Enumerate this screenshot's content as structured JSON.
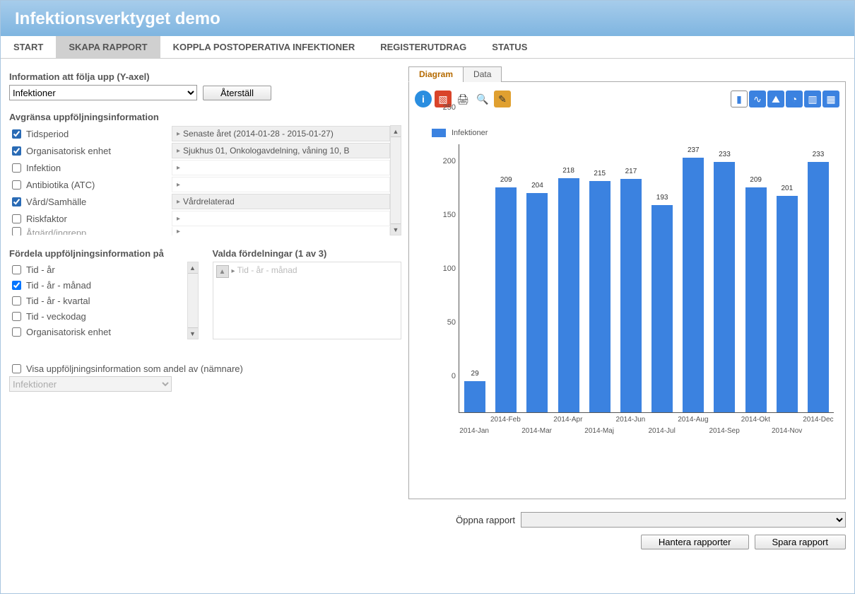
{
  "header": {
    "title": "Infektionsverktyget demo"
  },
  "tabs": [
    "START",
    "SKAPA RAPPORT",
    "KOPPLA POSTOPERATIVA INFEKTIONER",
    "REGISTERUTDRAG"
  ],
  "tabs_right": "STATUS",
  "active_tab_index": 1,
  "yaxis": {
    "label": "Information att följa upp (Y-axel)",
    "selected": "Infektioner",
    "reset_btn": "Återställ"
  },
  "filters": {
    "heading": "Avgränsa uppföljningsinformation",
    "items": [
      {
        "label": "Tidsperiod",
        "checked": true,
        "value": "Senaste året (2014-01-28 - 2015-01-27)"
      },
      {
        "label": "Organisatorisk enhet",
        "checked": true,
        "value": "Sjukhus 01, Onkologavdelning, våning 10, B"
      },
      {
        "label": "Infektion",
        "checked": false,
        "value": ""
      },
      {
        "label": "Antibiotika (ATC)",
        "checked": false,
        "value": ""
      },
      {
        "label": "Vård/Samhälle",
        "checked": true,
        "value": "Vårdrelaterad"
      },
      {
        "label": "Riskfaktor",
        "checked": false,
        "value": ""
      },
      {
        "label": "Åtgärd/ingrepp",
        "checked": false,
        "value": ""
      }
    ]
  },
  "distribution": {
    "heading": "Fördela uppföljningsinformation på",
    "items": [
      {
        "label": "Tid - år",
        "checked": false
      },
      {
        "label": "Tid - år - månad",
        "checked": true
      },
      {
        "label": "Tid - år - kvartal",
        "checked": false
      },
      {
        "label": "Tid - veckodag",
        "checked": false
      },
      {
        "label": "Organisatorisk enhet",
        "checked": false
      }
    ],
    "selected_heading": "Valda fördelningar (1 av 3)",
    "selected_item": "Tid - år - månad"
  },
  "denominator": {
    "checkbox_label": "Visa uppföljningsinformation som andel av (nämnare)",
    "selected": "Infektioner"
  },
  "chart_tabs": [
    "Diagram",
    "Data"
  ],
  "chart_active_tab": 0,
  "legend_label": "Infektioner",
  "open_report_label": "Öppna rapport",
  "manage_btn": "Hantera rapporter",
  "save_btn": "Spara rapport",
  "chart_data": {
    "type": "bar",
    "title": "",
    "xlabel": "",
    "ylabel": "",
    "ylim": [
      0,
      250
    ],
    "yticks": [
      0,
      50,
      100,
      150,
      200,
      250
    ],
    "categories": [
      "2014-Jan",
      "2014-Feb",
      "2014-Mar",
      "2014-Apr",
      "2014-Maj",
      "2014-Jun",
      "2014-Jul",
      "2014-Aug",
      "2014-Sep",
      "2014-Okt",
      "2014-Nov",
      "2014-Dec"
    ],
    "values": [
      29,
      209,
      204,
      218,
      215,
      217,
      193,
      237,
      233,
      209,
      201,
      233
    ],
    "series_name": "Infektioner"
  }
}
